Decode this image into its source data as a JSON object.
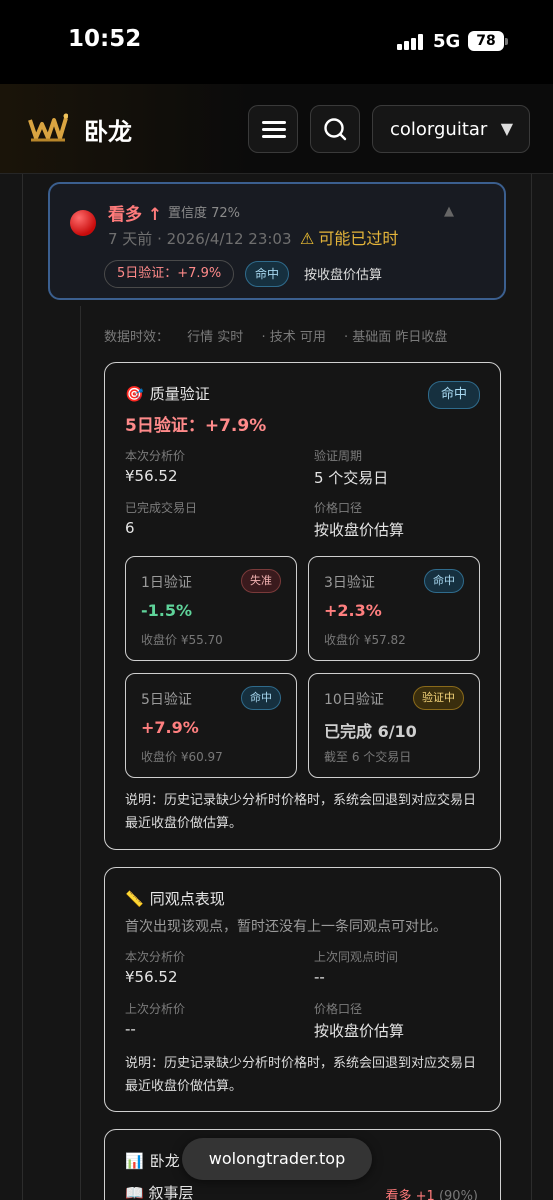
{
  "status_bar": {
    "time": "10:52",
    "network": "5G",
    "battery": "78"
  },
  "header": {
    "brand": "卧龙",
    "user": "colorguitar",
    "user_caret": "▼",
    "logo_icon": "crown-logo-icon"
  },
  "summary": {
    "verdict": "看多 ↑",
    "confidence": "置信度 72%",
    "timestamp": "7 天前 · 2026/4/12 23:03",
    "warning": "可能已过时",
    "result_pill": "5日验证：+7.9%",
    "hit_badge": "命中",
    "price_basis": "按收盘价估算",
    "caret": "▲"
  },
  "freshness": {
    "label": "数据时效：",
    "quotes": "行情 实时",
    "technical": "· 技术 可用",
    "fundamental": "· 基础面 昨日收盘"
  },
  "quality": {
    "title": "质量验证",
    "badge": "命中",
    "result": "5日验证：+7.9%",
    "analysis_price_label": "本次分析价",
    "analysis_price": "¥56.52",
    "period_label": "验证周期",
    "period": "5 个交易日",
    "completed_label": "已完成交易日",
    "completed": "6",
    "basis_label": "价格口径",
    "basis": "按收盘价估算",
    "boxes": [
      {
        "title": "1日验证",
        "badge": "失准",
        "value": "-1.5%",
        "sub": "收盘价 ¥55.70"
      },
      {
        "title": "3日验证",
        "badge": "命中",
        "value": "+2.3%",
        "sub": "收盘价 ¥57.82"
      },
      {
        "title": "5日验证",
        "badge": "命中",
        "value": "+7.9%",
        "sub": "收盘价 ¥60.97"
      },
      {
        "title": "10日验证",
        "badge": "验证中",
        "value": "已完成 6/10",
        "sub": "截至 6 个交易日"
      }
    ],
    "note": "说明：历史记录缺少分析时价格时，系统会回退到对应交易日最近收盘价做估算。"
  },
  "same_view": {
    "title": "同观点表现",
    "desc": "首次出现该观点，暂时还没有上一条同观点可对比。",
    "analysis_price_label": "本次分析价",
    "analysis_price": "¥56.52",
    "last_time_label": "上次同观点时间",
    "last_time": "--",
    "last_price_label": "上次分析价",
    "last_price": "--",
    "basis_label": "价格口径",
    "basis": "按收盘价估算",
    "note": "说明：历史记录缺少分析时价格时，系统会回退到对应交易日最近收盘价做估算。"
  },
  "third": {
    "title": "卧龙",
    "row_label": "叙事层",
    "row_value": "看多 +1",
    "row_pct": "(90%)"
  },
  "toast": "wolongtrader.top"
}
